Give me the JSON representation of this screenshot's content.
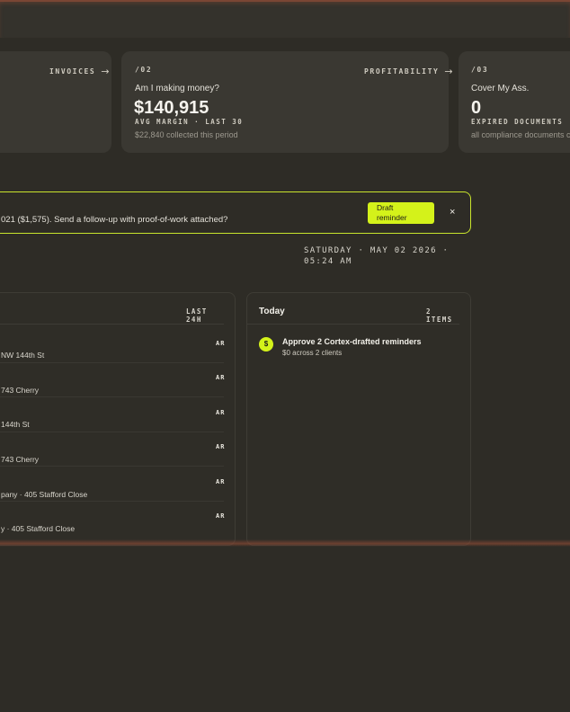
{
  "cards": [
    {
      "link": "INVOICES"
    },
    {
      "num": "/02",
      "link": "PROFITABILITY",
      "question": "Am I making money?",
      "value": "$140,915",
      "caption": "AVG MARGIN · LAST 30",
      "sub": "$22,840 collected this period"
    },
    {
      "num": "/03",
      "question": "Cover My Ass.",
      "value": "0",
      "caption": "EXPIRED DOCUMENTS",
      "sub": "all compliance documents cu"
    }
  ],
  "alert": {
    "message": "021 ($1,575). Send a follow-up with proof-of-work attached?",
    "button": "Draft reminder",
    "close": "×"
  },
  "clock": "SATURDAY · MAY 02 2026 · 05:24 AM",
  "activity": {
    "period": "LAST 24H",
    "rows": [
      {
        "tag": "AR",
        "text": "NW 144th St"
      },
      {
        "tag": "AR",
        "text": "743 Cherry"
      },
      {
        "tag": "AR",
        "text": "144th St"
      },
      {
        "tag": "AR",
        "text": "743 Cherry"
      },
      {
        "tag": "AR",
        "text": "pany · 405 Stafford Close"
      },
      {
        "tag": "AR",
        "text": "y · 405 Stafford Close"
      }
    ]
  },
  "today": {
    "title": "Today",
    "count": "2 ITEMS",
    "items": [
      {
        "icon": "dollar-icon",
        "symbol": "$",
        "title": "Approve 2 Cortex-drafted reminders",
        "sub": "$0 across 2 clients"
      }
    ]
  },
  "colors": {
    "accent": "#d4f21a",
    "background": "#2e2c26",
    "card": "#3a3832"
  }
}
